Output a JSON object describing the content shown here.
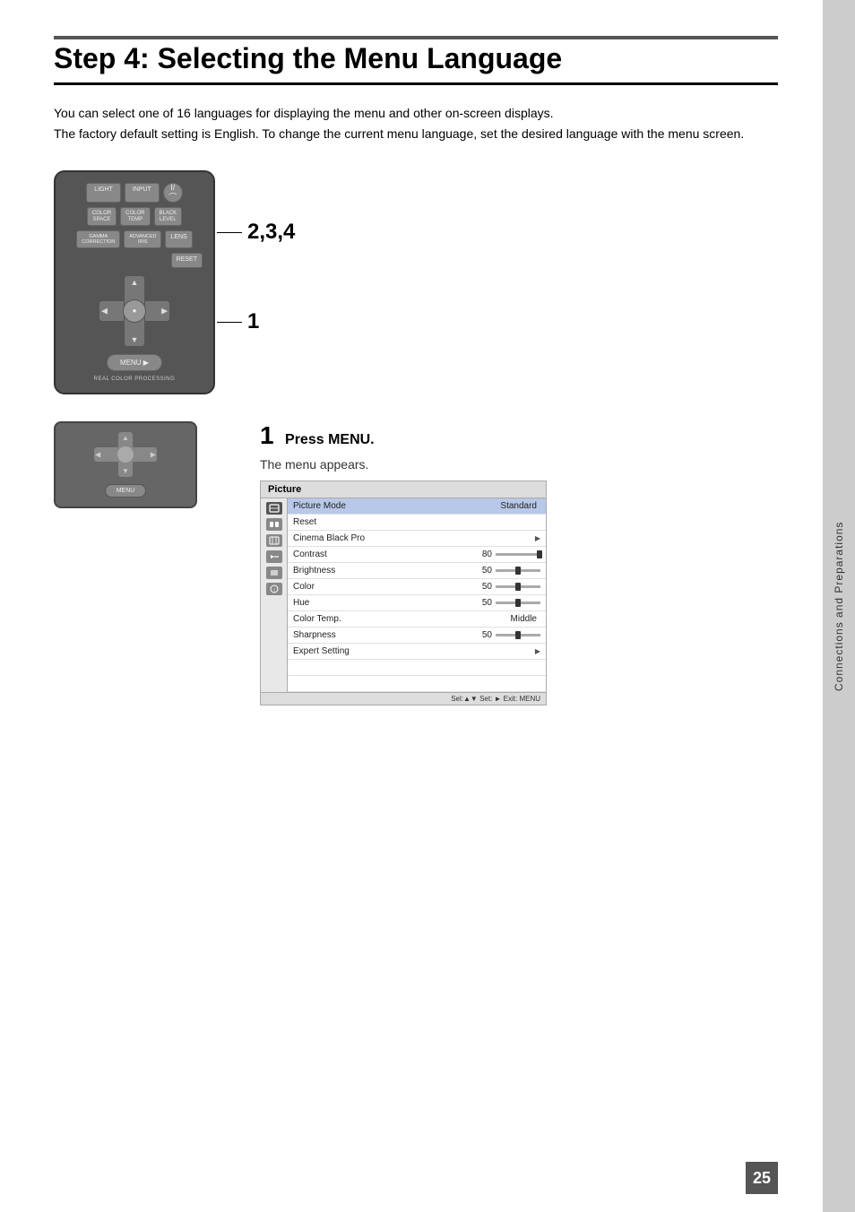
{
  "page": {
    "number": "25",
    "side_tab": "Connections and Preparations"
  },
  "title": "Step 4: Selecting the Menu Language",
  "intro": {
    "text1": "You can select one of 16 languages for displaying the menu and other on-screen displays.",
    "text2": "The factory default setting is English. To change the current menu language, set the desired language with the menu screen."
  },
  "remote": {
    "buttons": {
      "light": "LIGHT",
      "input": "INPUT",
      "power": "I/∧",
      "color_space": "COLOR\nSPACE",
      "color_temp": "COLOR\nTEMP",
      "black_level": "BLACK\nLEVEL",
      "gamma_correction": "GAMMA\nCORRECTION",
      "advanced_iris": "ADVANCED\nIRIS",
      "lens": "LENS",
      "reset": "RESET",
      "menu": "MENU ►",
      "label_bottom": "REAL COLOR PROCESSING"
    },
    "callout_234": "2,3,4",
    "callout_1": "1"
  },
  "steps": [
    {
      "number": "1",
      "action": "Press MENU.",
      "description": "The menu appears."
    }
  ],
  "menu_screen": {
    "header": "Picture",
    "items": [
      {
        "label": "Picture Mode",
        "value": "Standard",
        "has_bar": false,
        "has_arrow": false,
        "highlighted": true
      },
      {
        "label": "Reset",
        "value": "",
        "has_bar": false,
        "has_arrow": false,
        "highlighted": false
      },
      {
        "label": "Cinema Black Pro",
        "value": "",
        "has_bar": false,
        "has_arrow": true,
        "highlighted": false
      },
      {
        "label": "Contrast",
        "value": "80",
        "has_bar": true,
        "has_arrow": false,
        "highlighted": false
      },
      {
        "label": "Brightness",
        "value": "50",
        "has_bar": true,
        "has_arrow": false,
        "highlighted": false
      },
      {
        "label": "Color",
        "value": "50",
        "has_bar": true,
        "has_arrow": false,
        "highlighted": false
      },
      {
        "label": "Hue",
        "value": "50",
        "has_bar": true,
        "has_arrow": false,
        "highlighted": false
      },
      {
        "label": "Color Temp.",
        "value": "Middle",
        "has_bar": false,
        "has_arrow": false,
        "highlighted": false
      },
      {
        "label": "Sharpness",
        "value": "50",
        "has_bar": true,
        "has_arrow": false,
        "highlighted": false
      },
      {
        "label": "Expert Setting",
        "value": "",
        "has_bar": false,
        "has_arrow": true,
        "highlighted": false
      }
    ],
    "sidebar_icons": [
      "picture",
      "color",
      "screen",
      "input",
      "setup",
      "info"
    ],
    "footer": "Sel:▲▼  Set: ►  Exit: MENU"
  }
}
